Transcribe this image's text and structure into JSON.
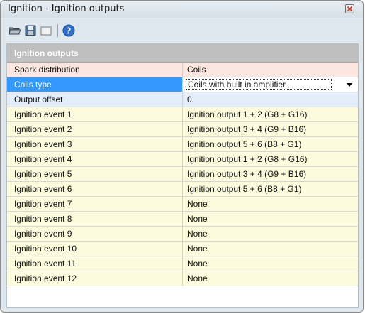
{
  "window": {
    "title": "Ignition - Ignition outputs"
  },
  "toolbar": {
    "icons": [
      "open-folder-icon",
      "save-icon",
      "window-icon",
      "help-icon"
    ]
  },
  "group": {
    "header": "Ignition outputs"
  },
  "rows": [
    {
      "name": "Spark distribution",
      "value": "Coils"
    },
    {
      "name": "Coils type",
      "value": "Coils with built in amplifier"
    },
    {
      "name": "Output offset",
      "value": "0"
    },
    {
      "name": "Ignition event 1",
      "value": "Ignition output 1 + 2 (G8 + G16)"
    },
    {
      "name": "Ignition event 2",
      "value": "Ignition output 3 + 4 (G9 + B16)"
    },
    {
      "name": "Ignition event 3",
      "value": "Ignition output 5 + 6 (B8 + G1)"
    },
    {
      "name": "Ignition event 4",
      "value": "Ignition output 1 + 2 (G8 + G16)"
    },
    {
      "name": "Ignition event 5",
      "value": "Ignition output 3 + 4 (G9 + B16)"
    },
    {
      "name": "Ignition event 6",
      "value": "Ignition output 5 + 6 (B8 + G1)"
    },
    {
      "name": "Ignition event 7",
      "value": "None"
    },
    {
      "name": "Ignition event 8",
      "value": "None"
    },
    {
      "name": "Ignition event 9",
      "value": "None"
    },
    {
      "name": "Ignition event 10",
      "value": "None"
    },
    {
      "name": "Ignition event 11",
      "value": "None"
    },
    {
      "name": "Ignition event 12",
      "value": "None"
    }
  ],
  "colors": {
    "selection": "#3399ff",
    "row_peach": "#fbe7df",
    "row_yellow": "#fdfbdd",
    "row_blue": "#e4eefb",
    "group_header": "#bfbfbf"
  }
}
